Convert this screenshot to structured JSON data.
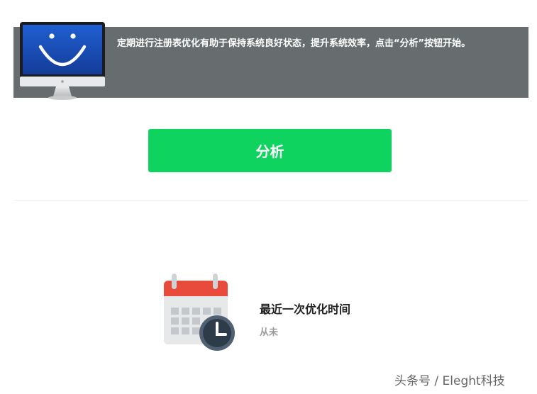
{
  "banner": {
    "text": "定期进行注册表优化有助于保持系统良好状态，提升系统效率，点击“分析”按钮开始。",
    "icon": "smiley-monitor-icon"
  },
  "actions": {
    "analyze_label": "分析",
    "accent_color": "#0fd35f"
  },
  "last_optimization": {
    "title": "最近一次优化时间",
    "value": "从未",
    "icon": "calendar-clock-icon"
  },
  "watermark": {
    "text": "头条号 / Eleght科技"
  }
}
